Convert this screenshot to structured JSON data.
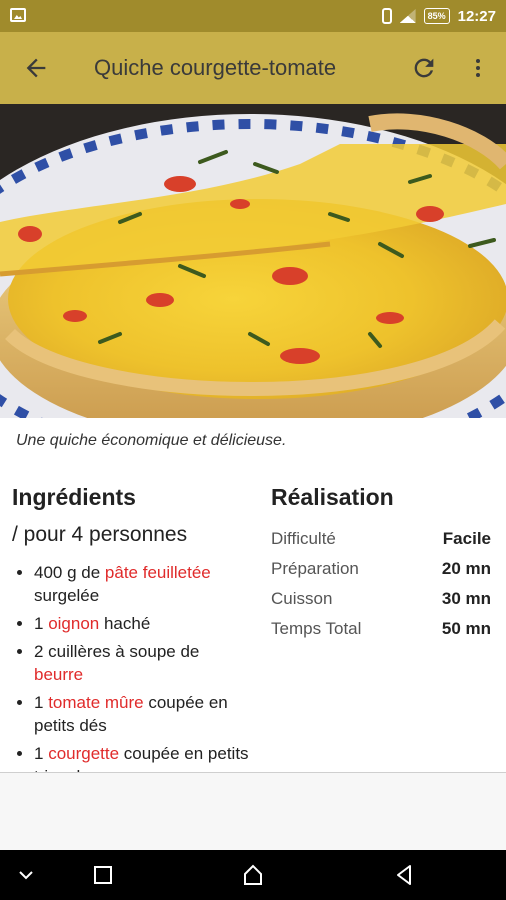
{
  "status_bar": {
    "battery": "85%",
    "time": "12:27"
  },
  "app_bar": {
    "title": "Quiche courgette-tomate"
  },
  "hero": {
    "caption": "Une quiche économique et délicieuse."
  },
  "ingredients": {
    "heading": "Ingrédients",
    "servings": "/ pour 4 personnes",
    "items": [
      {
        "pre": "400 g de ",
        "link": "pâte feuilletée",
        "post": " surgelée"
      },
      {
        "pre": "1 ",
        "link": "oignon",
        "post": " haché"
      },
      {
        "pre": "2 cuillères à soupe de ",
        "link": "beurre",
        "post": ""
      },
      {
        "pre": "1 ",
        "link": "tomate mûre",
        "post": " coupée en petits dés"
      },
      {
        "pre": "1 ",
        "link": "courgette",
        "post": " coupée en petits triangles"
      }
    ]
  },
  "realisation": {
    "heading": "Réalisation",
    "rows": [
      {
        "label": "Difficulté",
        "value": "Facile"
      },
      {
        "label": "Préparation",
        "value": "20 mn"
      },
      {
        "label": "Cuisson",
        "value": "30 mn"
      },
      {
        "label": "Temps Total",
        "value": "50 mn"
      }
    ]
  },
  "colors": {
    "status_bar": "#a08b2c",
    "app_bar": "#c8b04a",
    "link": "#e02b2b"
  },
  "icons": [
    "image-icon",
    "vibrate-icon",
    "signal-icon",
    "battery-icon",
    "back-arrow-icon",
    "refresh-icon",
    "more-vert-icon",
    "nav-down-icon",
    "nav-recents-icon",
    "nav-home-icon",
    "nav-back-icon"
  ]
}
